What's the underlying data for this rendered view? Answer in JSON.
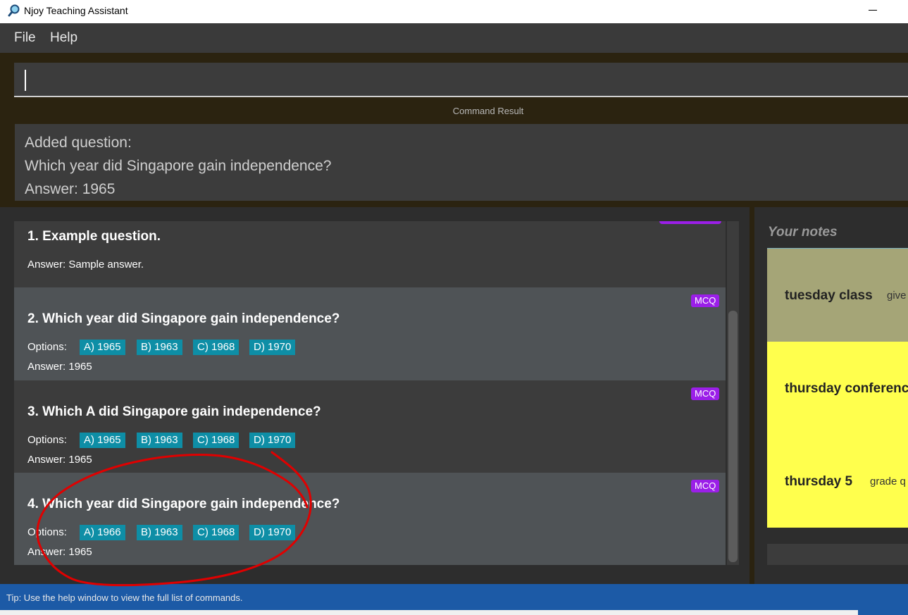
{
  "window": {
    "title": "Njoy Teaching Assistant"
  },
  "menu": {
    "file": "File",
    "help": "Help"
  },
  "command": {
    "value": ""
  },
  "result": {
    "label": "Command Result",
    "lines": [
      "Added question:",
      "Which year did Singapore gain independence?",
      "Answer: 1965"
    ]
  },
  "questions": [
    {
      "title": "1.  Example question.",
      "answer": "Answer: Sample answer.",
      "options": [],
      "tag": ""
    },
    {
      "title": "2.  Which year did Singapore gain independence?",
      "options_label": "Options:",
      "options": [
        "A) 1965",
        "B) 1963",
        "C) 1968",
        "D) 1970"
      ],
      "answer": "Answer: 1965",
      "tag": "MCQ"
    },
    {
      "title": "3.  Which A did Singapore gain independence?",
      "options_label": "Options:",
      "options": [
        "A) 1965",
        "B) 1963",
        "C) 1968",
        "D) 1970"
      ],
      "answer": "Answer: 1965",
      "tag": "MCQ"
    },
    {
      "title": "4.  Which year did Singapore gain independence?",
      "options_label": "Options:",
      "options": [
        "A) 1966",
        "B) 1963",
        "C) 1968",
        "D) 1970"
      ],
      "answer": "Answer: 1965",
      "tag": "MCQ"
    }
  ],
  "notes": {
    "title": "Your notes",
    "items": [
      {
        "title": "tuesday class",
        "body": "give",
        "color": "#a5a577"
      },
      {
        "title": "thursday conference",
        "body": "",
        "color": "#ffff4d"
      },
      {
        "title": "thursday 5",
        "body": "grade q",
        "color": "#ffff4d"
      }
    ]
  },
  "status": {
    "tip": "Tip: Use the help window to view the full list of commands."
  },
  "colors": {
    "background": "#2b2310",
    "option_chip": "#0e8ea6",
    "tag": "#9b1fe8",
    "statusbar": "#1c5aa6",
    "annotation": "#e00000"
  }
}
